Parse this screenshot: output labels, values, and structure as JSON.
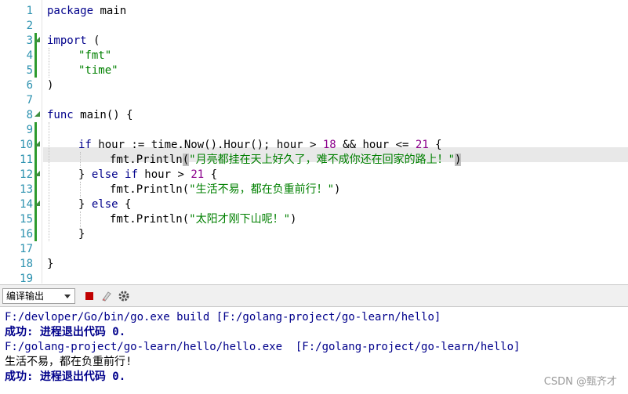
{
  "editor": {
    "line_numbers": [
      "1",
      "2",
      "3",
      "4",
      "5",
      "6",
      "7",
      "8",
      "9",
      "10",
      "11",
      "12",
      "13",
      "14",
      "15",
      "16",
      "17",
      "18",
      "19"
    ],
    "code": {
      "l1_kw": "package",
      "l1_rest": " main",
      "l3_kw": "import",
      "l3_rest": " (",
      "l4_str": "\"fmt\"",
      "l5_str": "\"time\"",
      "l6": ")",
      "l8_kw": "func",
      "l8_rest": " main() {",
      "l10_kw": "if",
      "l10_a": " hour := time.Now().Hour(); hour > ",
      "l10_n1": "18",
      "l10_b": " && hour <= ",
      "l10_n2": "21",
      "l10_c": " {",
      "l11_a": "fmt.Println",
      "l11_p1": "(",
      "l11_str": "\"月亮都挂在天上好久了，难不成你还在回家的路上！\"",
      "l11_p2": ")",
      "l12_a": "} ",
      "l12_kw1": "else",
      "l12_b": " ",
      "l12_kw2": "if",
      "l12_c": " hour > ",
      "l12_n": "21",
      "l12_d": " {",
      "l13_a": "fmt.Println(",
      "l13_str": "\"生活不易，都在负重前行！\"",
      "l13_b": ")",
      "l14_a": "} ",
      "l14_kw": "else",
      "l14_b": " {",
      "l15_a": "fmt.Println(",
      "l15_str": "\"太阳才刚下山呢！\"",
      "l15_b": ")",
      "l16": "}",
      "l18": "}"
    }
  },
  "toolbar": {
    "output_select": "编译输出",
    "icons": [
      "stop-icon",
      "clear-icon",
      "settings-icon"
    ],
    "colors": {
      "stop": "#c00000"
    }
  },
  "output": {
    "line1": "F:/devloper/Go/bin/go.exe build [F:/golang-project/go-learn/hello]",
    "line2": "成功: 进程退出代码 0.",
    "line3": "F:/golang-project/go-learn/hello/hello.exe  [F:/golang-project/go-learn/hello]",
    "line4": "生活不易，都在负重前行!",
    "line5": "成功: 进程退出代码 0."
  },
  "watermark": "CSDN @甄齐才"
}
